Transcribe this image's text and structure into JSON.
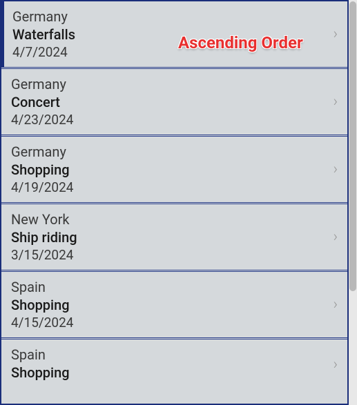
{
  "annotation": "Ascending Order",
  "items": [
    {
      "location": "Germany",
      "activity": "Waterfalls",
      "date": "4/7/2024"
    },
    {
      "location": "Germany",
      "activity": "Concert",
      "date": "4/23/2024"
    },
    {
      "location": "Germany",
      "activity": "Shopping",
      "date": "4/19/2024"
    },
    {
      "location": "New York",
      "activity": "Ship riding",
      "date": "3/15/2024"
    },
    {
      "location": "Spain",
      "activity": "Shopping",
      "date": "4/15/2024"
    },
    {
      "location": "Spain",
      "activity": "Shopping",
      "date": ""
    }
  ]
}
